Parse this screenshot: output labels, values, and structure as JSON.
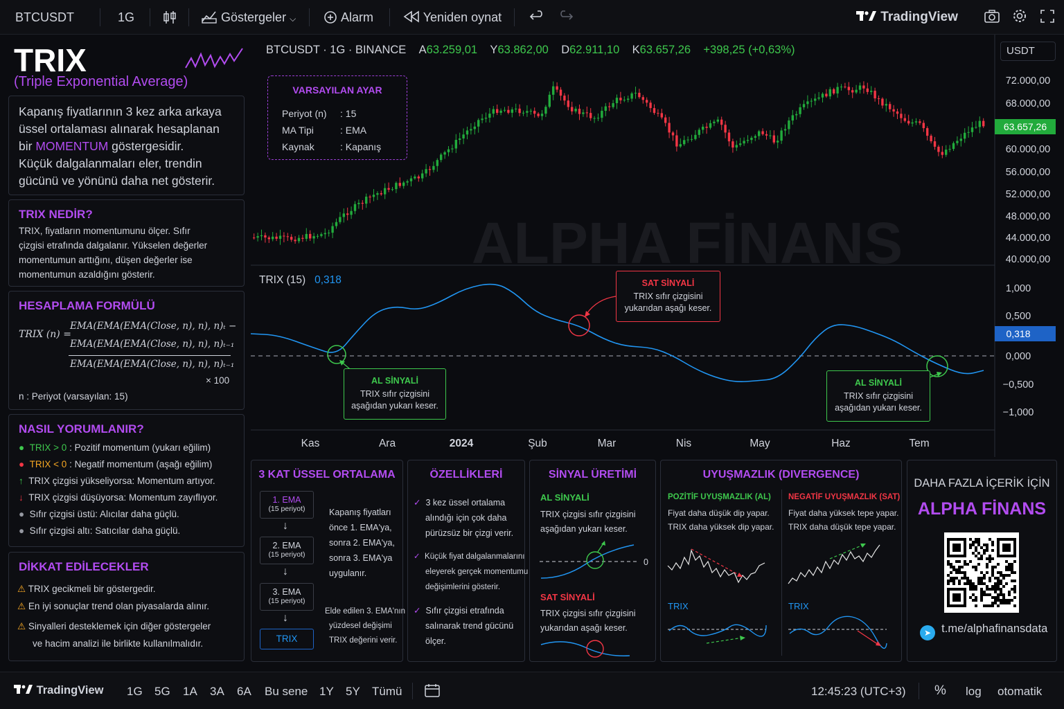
{
  "topbar": {
    "symbol": "BTCUSDT",
    "interval": "1G",
    "indicators_label": "Göstergeler",
    "alarm_label": "Alarm",
    "replay_label": "Yeniden oynat",
    "brand": "TradingView"
  },
  "legend": {
    "symbol_line": "BTCUSDT · 1G · BINANCE",
    "o_label": "A",
    "o_value": "63.259,01",
    "h_label": "Y",
    "h_value": "63.862,00",
    "l_label": "D",
    "l_value": "62.911,10",
    "c_label": "K",
    "c_value": "63.657,26",
    "change": "+398,25 (+0,63%)",
    "currency": "USDT"
  },
  "settings_box": {
    "title": "VARSAYILAN AYAR",
    "rows": [
      {
        "label": "Periyot (n)",
        "value": ": 15"
      },
      {
        "label": "MA Tipi",
        "value": ": EMA"
      },
      {
        "label": "Kaynak",
        "value": ": Kapanış"
      }
    ]
  },
  "watermark": "ALPHA FİNANS",
  "price_axis": {
    "ticks": [
      "72.000,00",
      "68.000,00",
      "64.000,00",
      "60.000,00",
      "56.000,00",
      "52.000,00",
      "48.000,00",
      "44.000,00",
      "40.000,00"
    ],
    "current": "63.657,26"
  },
  "trix_pane": {
    "label": "TRIX (15)",
    "value": "0,318",
    "ticks": [
      "1,000",
      "0,500",
      "0,000",
      "−0,500",
      "−1,000"
    ],
    "current": "0,318",
    "sell_box": {
      "title": "SAT SİNYALİ",
      "line1": "TRIX sıfır çizgisini",
      "line2": "yukarıdan aşağı keser."
    },
    "buy_box_1": {
      "title": "AL SİNYALİ",
      "line1": "TRIX sıfır çizgisini",
      "line2": "aşağıdan yukarı keser."
    },
    "buy_box_2": {
      "title": "AL SİNYALİ",
      "line1": "TRIX sıfır çizgisini",
      "line2": "aşağıdan yukarı keser."
    }
  },
  "time_axis": [
    "Kas",
    "Ara",
    "2024",
    "Şub",
    "Mar",
    "Nis",
    "May",
    "Haz",
    "Tem"
  ],
  "left": {
    "title": "TRIX",
    "subtitle": "(Triple Exponential Average)",
    "intro_1": "Kapanış fiyatlarının 3 kez arka arkaya",
    "intro_2": "üssel ortalaması alınarak hesaplanan",
    "intro_3a": "bir ",
    "intro_3b": "MOMENTUM",
    "intro_3c": " göstergesidir.",
    "intro_4": "Küçük dalgalanmaları eler, trendin",
    "intro_5": "gücünü ve yönünü daha net gösterir.",
    "what_title": "TRIX NEDİR?",
    "what_1": "TRIX, fiyatların momentumunu ölçer. Sıfır",
    "what_2": "çizgisi etrafında dalgalanır. Yükselen değerler",
    "what_3": "momentumun arttığını, düşen değerler ise",
    "what_4": "momentumun azaldığını gösterir.",
    "formula_title": "HESAPLAMA FORMÜLÜ",
    "formula_lhs": "TRIX (n) =",
    "formula_num1": "EMA(EMA(EMA(Close, n), n), n)ₜ −",
    "formula_num2": "EMA(EMA(EMA(Close, n), n), n)ₜ₋₁",
    "formula_den": "EMA(EMA(EMA(Close, n), n), n)ₜ₋₁",
    "formula_mult": "× 100",
    "formula_note": "n : Periyot (varsayılan: 15)",
    "interp_title": "NASIL YORUMLANIR?",
    "interp": [
      {
        "a": "TRIX > 0",
        "b": " : Pozitif momentum (yukarı eğilim)"
      },
      {
        "a": "TRIX < 0",
        "b": " : Negatif momentum (aşağı eğilim)"
      },
      {
        "a": "",
        "b": "TRIX çizgisi yükseliyorsa: Momentum artıyor."
      },
      {
        "a": "",
        "b": "TRIX çizgisi düşüyorsa: Momentum zayıflıyor."
      },
      {
        "a": "",
        "b": "Sıfır çizgisi üstü: Alıcılar daha güçlü."
      },
      {
        "a": "",
        "b": "Sıfır çizgisi altı: Satıcılar daha güçlü."
      }
    ],
    "caution_title": "DİKKAT EDİLECEKLER",
    "caution": [
      "TRIX gecikmeli bir göstergedir.",
      "En iyi sonuçlar trend olan piyasalarda alınır.",
      "Sinyalleri desteklemek için diğer göstergeler",
      "ve hacim analizi ile birlikte kullanılmalıdır."
    ]
  },
  "panels": {
    "triple": {
      "title": "3 KAT ÜSSEL ORTALAMA",
      "boxes": [
        {
          "name": "1. EMA",
          "sub": "(15 periyot)"
        },
        {
          "name": "2. EMA",
          "sub": "(15 periyot)"
        },
        {
          "name": "3. EMA",
          "sub": "(15 periyot)"
        }
      ],
      "trix_box": "TRIX",
      "desc": [
        "Kapanış fiyatları",
        "önce 1. EMA'ya,",
        "sonra 2. EMA'ya,",
        "sonra 3. EMA'ya",
        "uygulanır."
      ],
      "desc2": [
        "Elde edilen 3. EMA'nın",
        "yüzdesel değişimi",
        "TRIX değerini verir."
      ]
    },
    "features": {
      "title": "ÖZELLİKLERİ",
      "items": [
        [
          "3 kez üssel ortalama",
          "alındığı için çok daha",
          "pürüzsüz bir çizgi verir."
        ],
        [
          "Küçük fiyat dalgalanmalarını",
          "eleyerek gerçek momentumu",
          "değişimlerini gösterir."
        ],
        [
          "Sıfır çizgisi etrafında",
          "salınarak trend gücünü",
          "ölçer."
        ]
      ]
    },
    "signal": {
      "title": "SİNYAL ÜRETİMİ",
      "buy_title": "AL SİNYALİ",
      "buy_1": "TRIX çizgisi sıfır çizgisini",
      "buy_2": "aşağıdan yukarı keser.",
      "zero": "0",
      "sell_title": "SAT SİNYALİ",
      "sell_1": "TRIX çizgisi sıfır çizgisini",
      "sell_2": "yukarıdan aşağı keser."
    },
    "divergence": {
      "title": "UYUŞMAZLIK (DIVERGENCE)",
      "pos_title": "POZİTİF UYUŞMAZLIK (AL)",
      "pos_1": "Fiyat daha düşük dip yapar.",
      "pos_2": "TRIX daha yüksek dip yapar.",
      "neg_title": "NEGATİF UYUŞMAZLIK (SAT)",
      "neg_1": "Fiyat daha yüksek tepe yapar.",
      "neg_2": "TRIX daha düşük tepe yapar.",
      "trix_label_1": "TRIX",
      "trix_label_2": "TRIX"
    },
    "promo": {
      "line1": "DAHA FAZLA İÇERİK İÇİN",
      "brand": "ALPHA FİNANS",
      "telegram": "t.me/alphafinansdata"
    }
  },
  "bottombar": {
    "brand": "TradingView",
    "ranges": [
      "1G",
      "5G",
      "1A",
      "3A",
      "6A",
      "Bu sene",
      "1Y",
      "5Y",
      "Tümü"
    ],
    "time": "12:45:23 (UTC+3)",
    "percent": "%",
    "log": "log",
    "auto": "otomatik"
  },
  "colors": {
    "accent": "#b24cf0",
    "up": "#26a69a",
    "up_bright": "#3ec84d",
    "down": "#f23645",
    "trix_line": "#2196f3",
    "price_tag": "#22ab3c"
  }
}
